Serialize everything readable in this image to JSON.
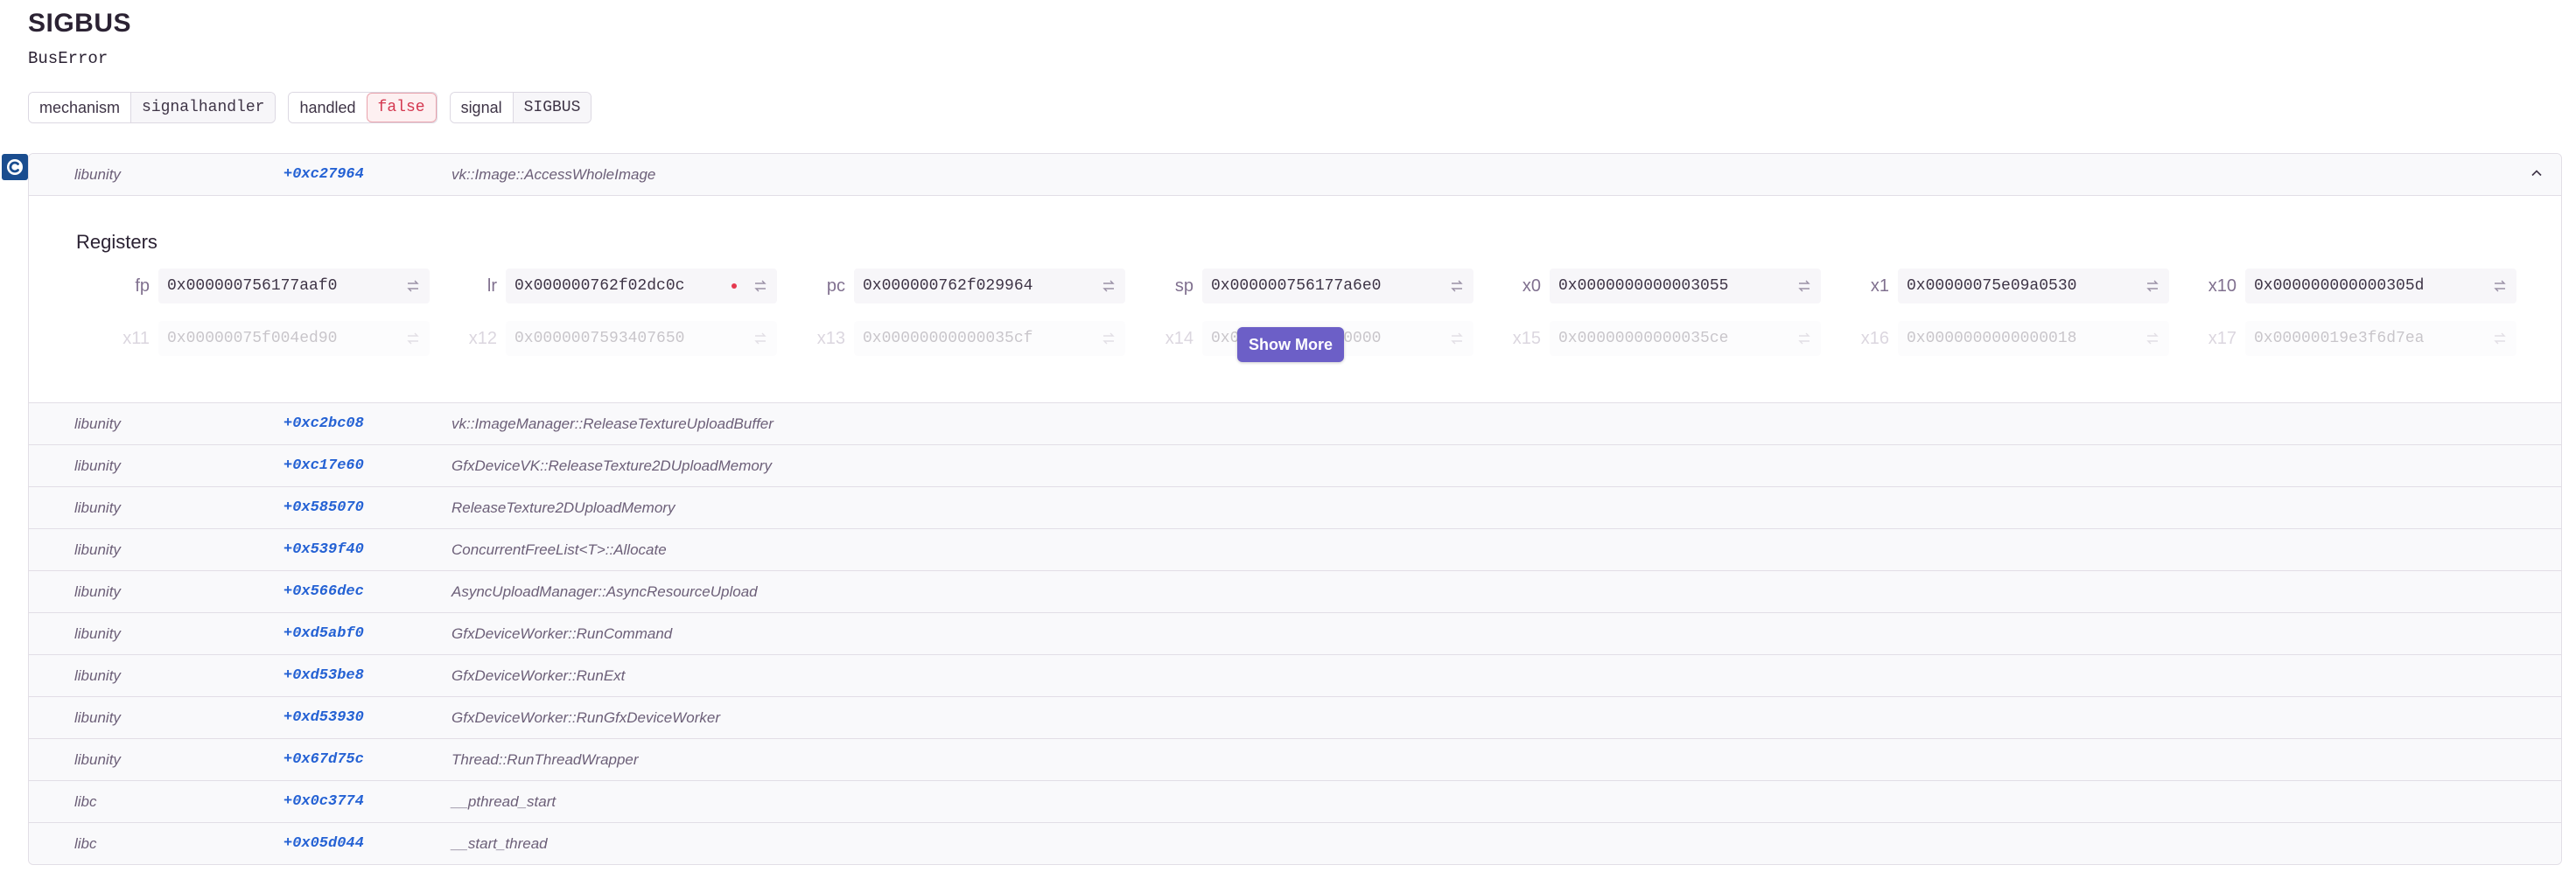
{
  "exception": {
    "title": "SIGBUS",
    "type": "BusError"
  },
  "tags": [
    {
      "key": "mechanism",
      "value": "signalhandler"
    },
    {
      "key": "handled",
      "value": "false"
    },
    {
      "key": "signal",
      "value": "SIGBUS"
    }
  ],
  "frames": [
    {
      "package": "libunity",
      "address": "+0xc27964",
      "function": "vk::Image::AccessWholeImage"
    },
    {
      "package": "libunity",
      "address": "+0xc2bc08",
      "function": "vk::ImageManager::ReleaseTextureUploadBuffer"
    },
    {
      "package": "libunity",
      "address": "+0xc17e60",
      "function": "GfxDeviceVK::ReleaseTexture2DUploadMemory"
    },
    {
      "package": "libunity",
      "address": "+0x585070",
      "function": "ReleaseTexture2DUploadMemory"
    },
    {
      "package": "libunity",
      "address": "+0x539f40",
      "function": "ConcurrentFreeList<T>::Allocate"
    },
    {
      "package": "libunity",
      "address": "+0x566dec",
      "function": "AsyncUploadManager::AsyncResourceUpload"
    },
    {
      "package": "libunity",
      "address": "+0xd5abf0",
      "function": "GfxDeviceWorker::RunCommand"
    },
    {
      "package": "libunity",
      "address": "+0xd53be8",
      "function": "GfxDeviceWorker::RunExt"
    },
    {
      "package": "libunity",
      "address": "+0xd53930",
      "function": "GfxDeviceWorker::RunGfxDeviceWorker"
    },
    {
      "package": "libunity",
      "address": "+0x67d75c",
      "function": "Thread::RunThreadWrapper"
    },
    {
      "package": "libc",
      "address": "+0x0c3774",
      "function": "__pthread_start"
    },
    {
      "package": "libc",
      "address": "+0x05d044",
      "function": "__start_thread"
    }
  ],
  "registers": {
    "title": "Registers",
    "show_more_label": "Show More",
    "row1": [
      {
        "name": "fp",
        "value": "0x000000756177aaf0"
      },
      {
        "name": "lr",
        "value": "0x000000762f02dc0c"
      },
      {
        "name": "pc",
        "value": "0x000000762f029964"
      },
      {
        "name": "sp",
        "value": "0x000000756177a6e0"
      },
      {
        "name": "x0",
        "value": "0x0000000000003055"
      },
      {
        "name": "x1",
        "value": "0x00000075e09a0530"
      },
      {
        "name": "x10",
        "value": "0x000000000000305d"
      }
    ],
    "row2": [
      {
        "name": "x11",
        "value": "0x00000075f004ed90"
      },
      {
        "name": "x12",
        "value": "0x0000007593407650"
      },
      {
        "name": "x13",
        "value": "0x00000000000035cf"
      },
      {
        "name": "x14",
        "value": "0x0000000000000000"
      },
      {
        "name": "x15",
        "value": "0x00000000000035ce"
      },
      {
        "name": "x16",
        "value": "0x0000000000000018"
      },
      {
        "name": "x17",
        "value": "0x00000019e3f6d7ea"
      }
    ]
  },
  "colors": {
    "accent": "#6c5fc7",
    "address": "#2562d4",
    "error": "#d4374f"
  }
}
